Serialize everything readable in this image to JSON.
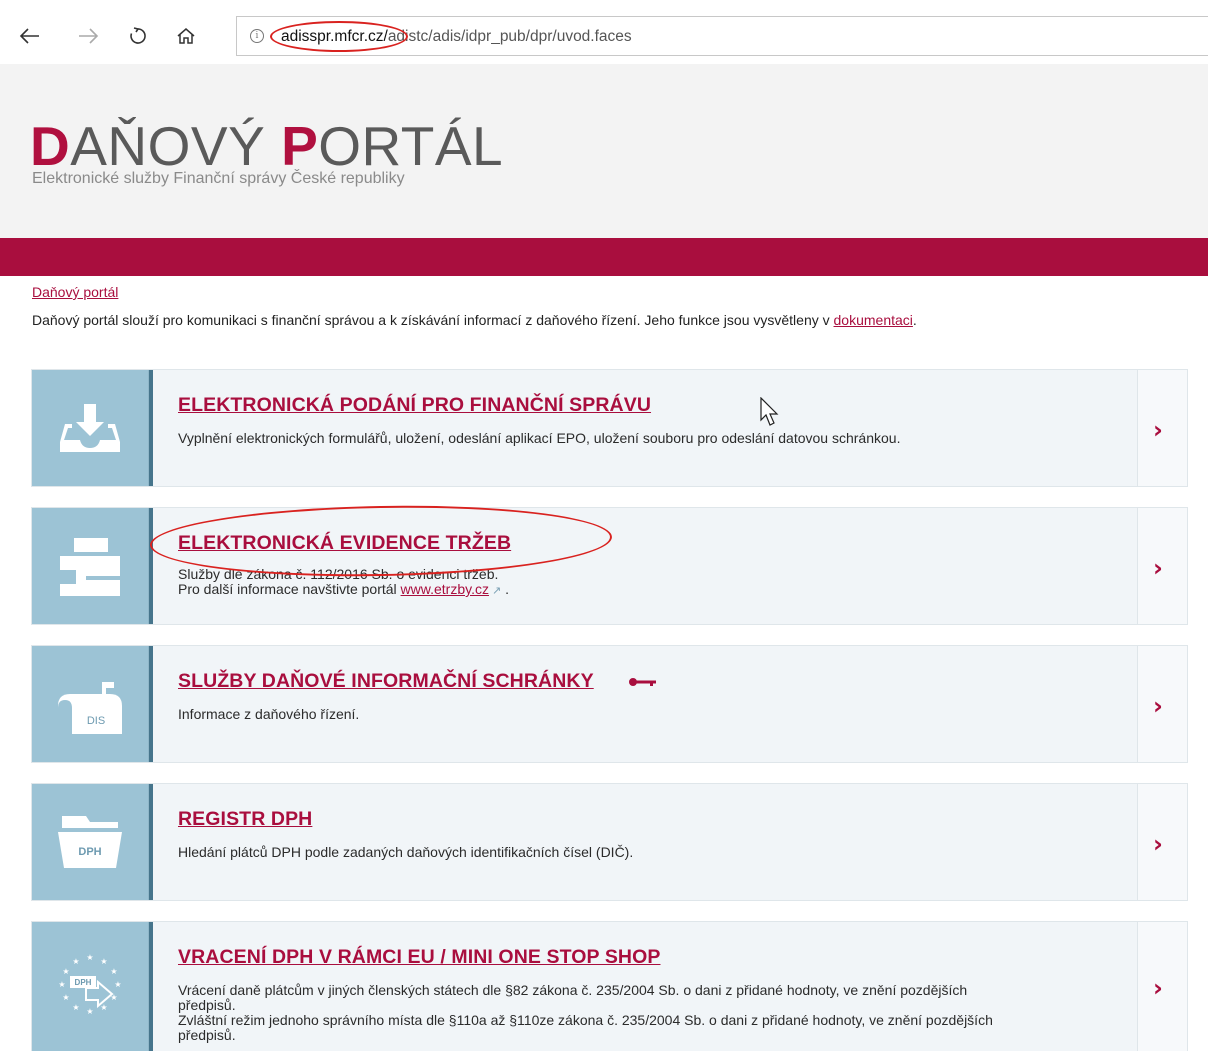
{
  "browser": {
    "url_host": "adisspr.mfcr.cz/",
    "url_path": "adistc/adis/idpr_pub/dpr/uvod.faces",
    "info_glyph": "i"
  },
  "header": {
    "logo_part1_accent": "D",
    "logo_part1_rest": "AŇOVÝ ",
    "logo_part2_accent": "P",
    "logo_part2_rest": "ORTÁL",
    "subtitle": "Elektronické služby Finanční správy České republiky"
  },
  "breadcrumb": "Daňový portál",
  "intro": {
    "text": "Daňový portál slouží pro komunikaci s finanční správou a k získávání informací z daňového řízení. Jeho funkce jsou vysvětleny v ",
    "link": "dokumentaci",
    "suffix": "."
  },
  "cards": [
    {
      "title": "ELEKTRONICKÁ PODÁNÍ PRO FINANČNÍ SPRÁVU",
      "desc": "Vyplnění elektronických formulářů, uložení, odeslání aplikací EPO, uložení souboru pro odeslání datovou schránkou.",
      "icon": "inbox-download-icon"
    },
    {
      "title": "ELEKTRONICKÁ EVIDENCE TRŽEB",
      "desc_line1": "Služby dle zákona č. 112/2016 Sb. o evidenci tržeb.",
      "desc_line2_prefix": "Pro další informace navštivte portál ",
      "desc_line2_link": "www.etrzby.cz",
      "desc_line2_suffix": " .",
      "icon": "cash-register-icon"
    },
    {
      "title": "SLUŽBY DAŇOVÉ INFORMAČNÍ SCHRÁNKY",
      "desc": "Informace z daňového řízení.",
      "icon_label": "DIS",
      "icon": "mailbox-icon"
    },
    {
      "title": "REGISTR DPH",
      "desc": "Hledání plátců DPH podle zadaných daňových identifikačních čísel (DIČ).",
      "icon_label": "DPH",
      "icon": "folder-icon"
    },
    {
      "title": "VRACENÍ DPH V RÁMCI EU / MINI ONE STOP SHOP",
      "desc_line1": "Vrácení daně plátcům v jiných členských státech dle §82 zákona č. 235/2004 Sb. o dani z přidané hodnoty, ve znění pozdějších",
      "desc_line2": "předpisů.",
      "desc_line3": "Zvláštní režim jednoho správního místa dle §110a až §110ze zákona č. 235/2004 Sb. o dani z přidané hodnoty, ve znění pozdějších",
      "desc_line4": "předpisů.",
      "icon_label": "DPH",
      "icon": "eu-stars-icon"
    }
  ],
  "arrow_glyph": "›",
  "colors": {
    "accent": "#a90e3e",
    "icon_bg": "#9cc3d5",
    "card_bg": "#f1f5f8",
    "annotation": "#d9221f"
  }
}
